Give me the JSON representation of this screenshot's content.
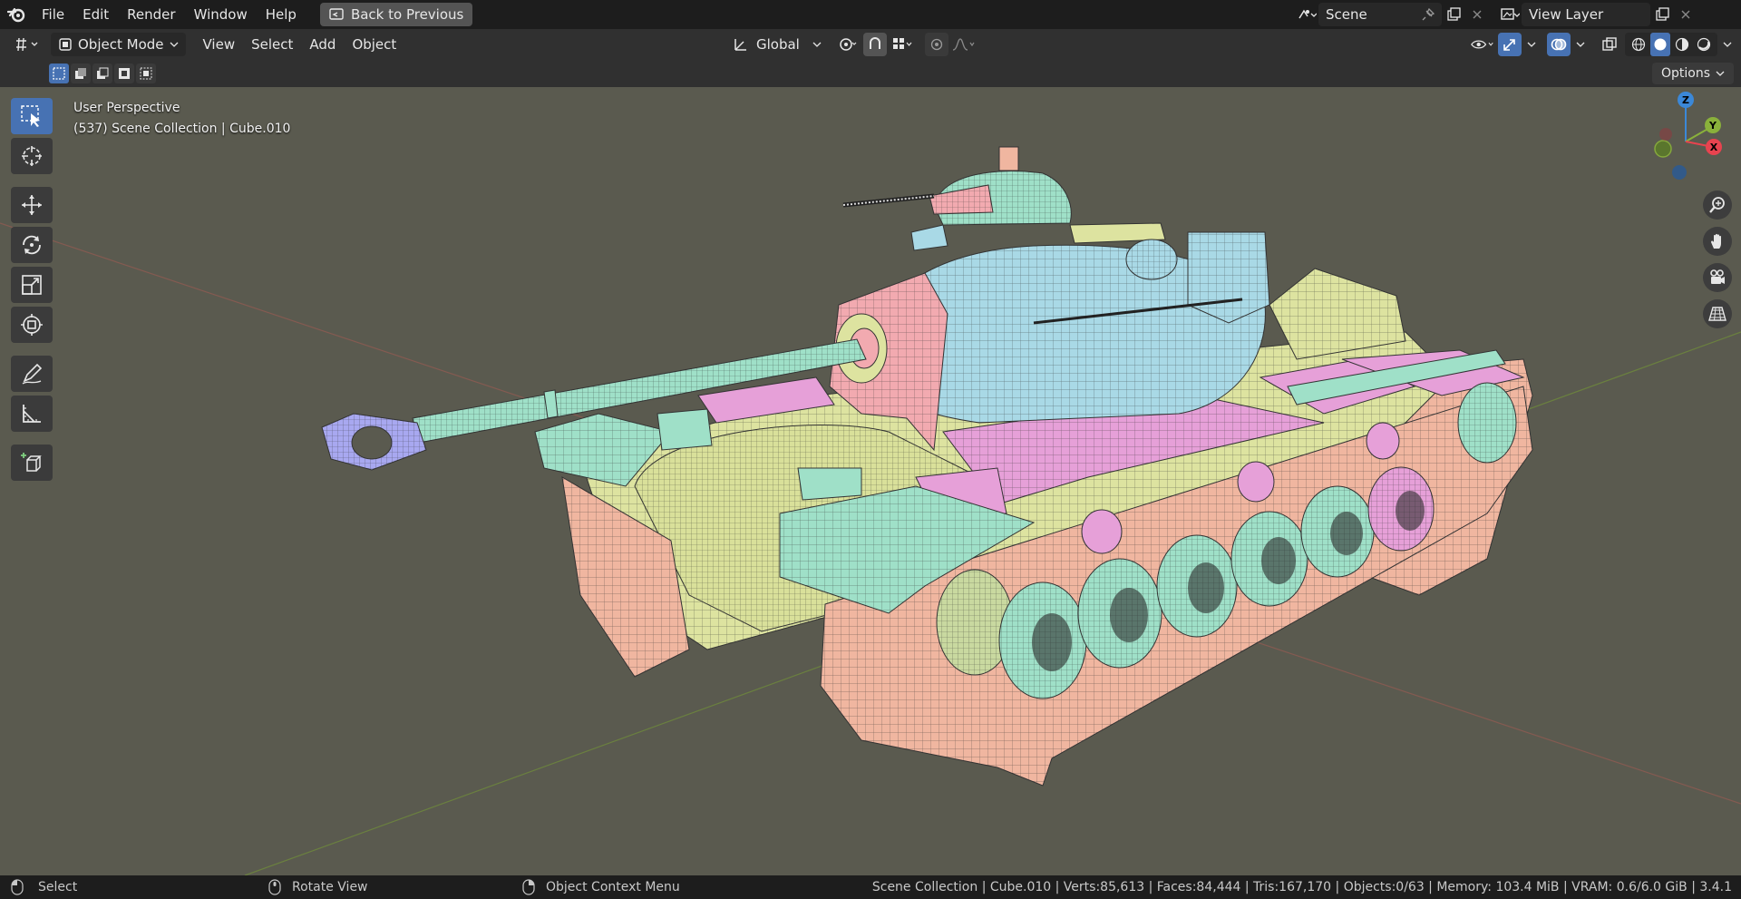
{
  "topbar": {
    "menus": [
      "File",
      "Edit",
      "Render",
      "Window",
      "Help"
    ],
    "back_button": "Back to Previous",
    "scene_name": "Scene",
    "view_layer": "View Layer"
  },
  "header": {
    "mode": "Object Mode",
    "menus": [
      "View",
      "Select",
      "Add",
      "Object"
    ],
    "orientation": "Global"
  },
  "toolrow": {
    "options_label": "Options"
  },
  "viewport": {
    "perspective": "User Perspective",
    "collection_line": "(537) Scene Collection | Cube.010",
    "background_color": "#5a5a4f"
  },
  "gizmo": {
    "z": "Z",
    "y": "Y",
    "x": "X"
  },
  "statusbar": {
    "left_action": "Select",
    "middle_action": "Rotate View",
    "right_action": "Object Context Menu",
    "stats": "Scene Collection | Cube.010 | Verts:85,613 | Faces:84,444 | Tris:167,170 | Objects:0/63 | Memory: 103.4 MiB | VRAM: 0.6/6.0 GiB | 3.4.1"
  },
  "colors": {
    "accent": "#4772b3",
    "turret": "#a9d9e6",
    "hull": "#dde3a0",
    "track": "#f0b6a0",
    "wheels": "#9fe0c8",
    "panels": "#e6a0d8",
    "mantlet": "#f2aab0",
    "muzzle": "#a8a8f0",
    "axis_x": "#e8434f",
    "axis_y": "#8ab13b",
    "axis_z": "#3b88d8"
  }
}
